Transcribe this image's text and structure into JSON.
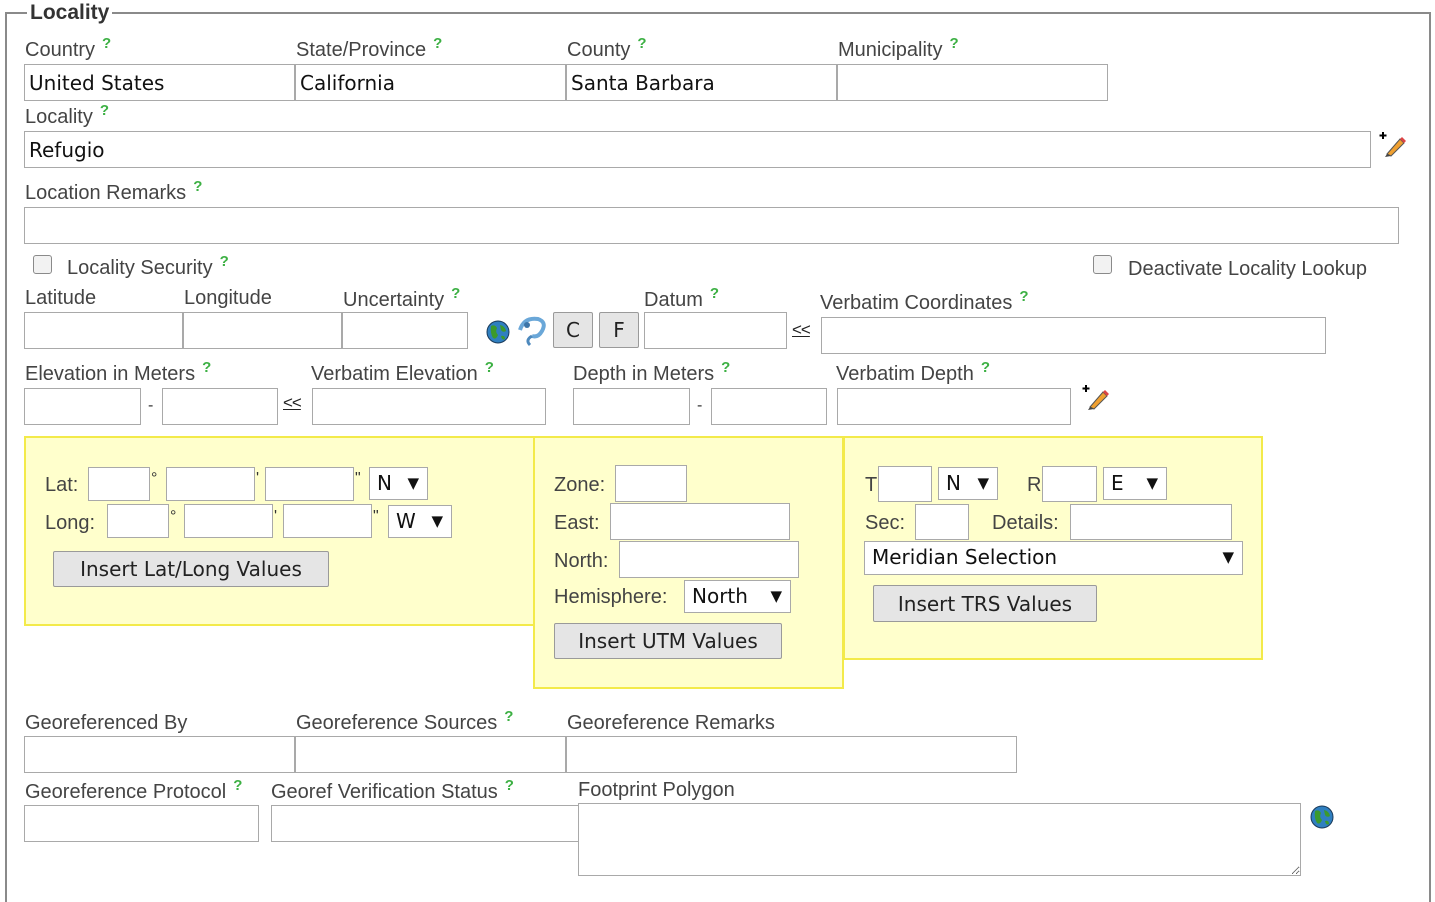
{
  "section": {
    "title": "Locality"
  },
  "help_glyph": "?",
  "fields": {
    "country": {
      "label": "Country",
      "value": "United States"
    },
    "state": {
      "label": "State/Province",
      "value": "California"
    },
    "county": {
      "label": "County",
      "value": "Santa Barbara"
    },
    "municipality": {
      "label": "Municipality",
      "value": ""
    },
    "locality": {
      "label": "Locality",
      "value": "Refugio"
    },
    "location_remarks": {
      "label": "Location Remarks",
      "value": ""
    },
    "locality_security": {
      "label": "Locality Security"
    },
    "deactivate_lookup": {
      "label": "Deactivate Locality Lookup"
    },
    "latitude": {
      "label": "Latitude",
      "value": ""
    },
    "longitude": {
      "label": "Longitude",
      "value": ""
    },
    "uncertainty": {
      "label": "Uncertainty",
      "value": ""
    },
    "datum": {
      "label": "Datum",
      "value": ""
    },
    "verbatim_coordinates": {
      "label": "Verbatim Coordinates",
      "value": ""
    },
    "elevation": {
      "label": "Elevation in Meters"
    },
    "verbatim_elevation": {
      "label": "Verbatim Elevation"
    },
    "depth": {
      "label": "Depth in Meters"
    },
    "verbatim_depth": {
      "label": "Verbatim Depth"
    },
    "georeferenced_by": {
      "label": "Georeferenced By"
    },
    "georeference_sources": {
      "label": "Georeference Sources"
    },
    "georeference_remarks": {
      "label": "Georeference Remarks"
    },
    "georeference_protocol": {
      "label": "Georeference Protocol"
    },
    "georef_verification_status": {
      "label": "Georef Verification Status"
    },
    "footprint_polygon": {
      "label": "Footprint Polygon"
    }
  },
  "buttons": {
    "c": "C",
    "f": "F"
  },
  "copy_link": "<<",
  "range_dash": "-",
  "latlong_box": {
    "lat_label": "Lat:",
    "long_label": "Long:",
    "degree_symbol": "°",
    "minute_symbol": "'",
    "second_symbol": "\"",
    "lat_dir": "N",
    "long_dir": "W",
    "insert_button": "Insert Lat/Long Values"
  },
  "utm_box": {
    "zone_label": "Zone:",
    "east_label": "East:",
    "north_label": "North:",
    "hemisphere_label": "Hemisphere:",
    "hemisphere_value": "North",
    "insert_button": "Insert UTM Values"
  },
  "trs_box": {
    "t_label": "T",
    "t_dir": "N",
    "r_label": "R",
    "r_dir": "E",
    "sec_label": "Sec:",
    "details_label": "Details:",
    "meridian_value": "Meridian Selection",
    "insert_button": "Insert TRS Values"
  },
  "dropdown_arrow": "▼"
}
